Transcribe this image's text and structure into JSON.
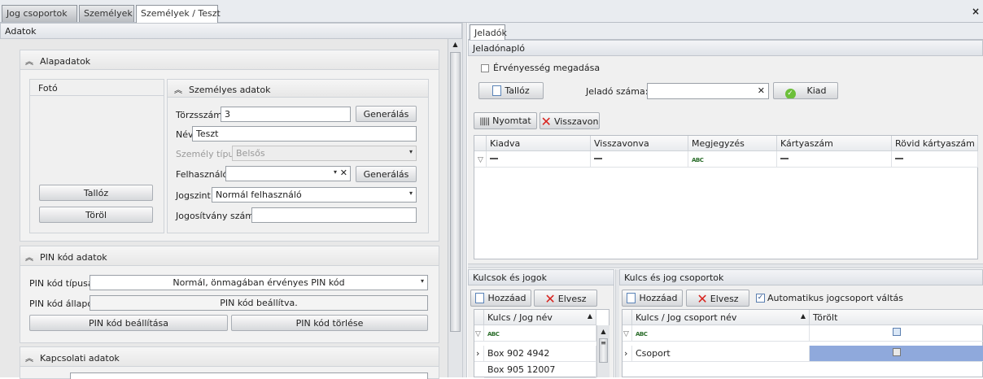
{
  "tabs": [
    {
      "label": "Jog csoportok"
    },
    {
      "label": "Személyek"
    },
    {
      "label": "Személyek / Teszt"
    }
  ],
  "close": "×",
  "left": {
    "title": "Adatok",
    "alap": {
      "title": "Alapadatok",
      "foto": "Fotó",
      "browse": "Tallóz",
      "delete": "Töröl",
      "personal": {
        "title": "Személyes adatok",
        "torzsszam_label": "Törzsszám",
        "torzsszam": "3",
        "generate": "Generálás",
        "nev_label": "Név",
        "nev": "Teszt",
        "tipus_label": "Személy típus",
        "tipus": "Belsős",
        "felh_label": "Felhasználó",
        "felh": "",
        "generate2": "Generálás",
        "jog_label": "Jogszint",
        "jog": "Normál felhasználó",
        "jogos_label": "Jogosítvány szám:",
        "jogos": ""
      }
    },
    "pin": {
      "title": "PIN kód adatok",
      "tipus_label": "PIN kód típusa",
      "tipus": "Normál, önmagában érvényes PIN kód",
      "allapot_label": "PIN kód állapot",
      "allapot": "PIN kód beállítva.",
      "set": "PIN kód beállítása",
      "del": "PIN kód törlése"
    },
    "kapcs": {
      "title": "Kapcsolati adatok"
    }
  },
  "right": {
    "tab": "Jeladók",
    "naplo": "Jeladónapló",
    "valid_cb": "Érvényesség megadása",
    "browse": "Tallóz",
    "jelado_label": "Jeladó száma:",
    "jelado": "",
    "kiad": "Kiad",
    "print": "Nyomtat",
    "revoke": "Visszavon",
    "cols": [
      "Kiadva",
      "Visszavonva",
      "Megjegyzés",
      "Kártyaszám",
      "Rövid kártyaszám"
    ],
    "keys": {
      "title": "Kulcsok és jogok",
      "add": "Hozzáad",
      "remove": "Elvesz",
      "col": "Kulcs / Jog név",
      "rows": [
        "Box 902 4942",
        "Box 905 12007"
      ]
    },
    "groups": {
      "title": "Kulcs és jog csoportok",
      "add": "Hozzáad",
      "remove": "Elvesz",
      "auto": "Automatikus jogcsoport váltás",
      "col1": "Kulcs / Jog csoport név",
      "col2": "Törölt",
      "rows": [
        "Csoport"
      ]
    }
  }
}
